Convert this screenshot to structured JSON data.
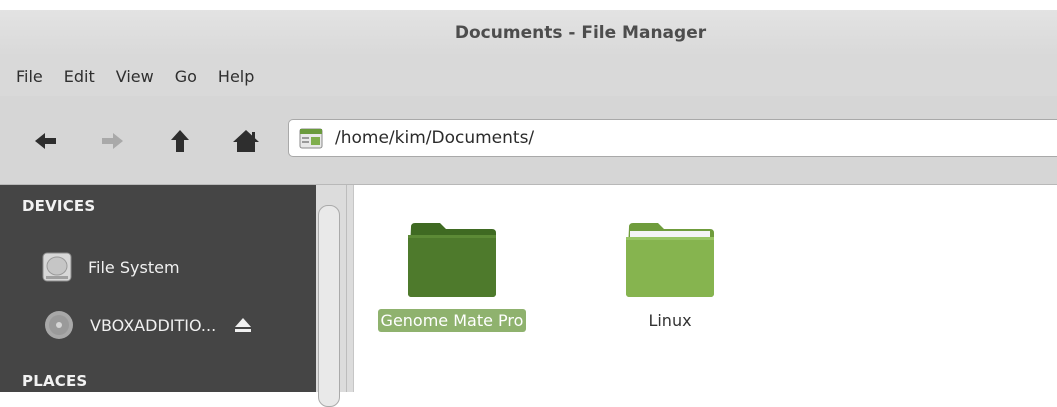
{
  "window": {
    "title": "Documents - File Manager"
  },
  "menu": [
    "File",
    "Edit",
    "View",
    "Go",
    "Help"
  ],
  "toolbar": {
    "back": "back-arrow-icon",
    "forward": "forward-arrow-icon",
    "up": "up-arrow-icon",
    "home": "home-icon"
  },
  "location": {
    "path": "/home/kim/Documents/"
  },
  "sidebar": {
    "devices_heading": "DEVICES",
    "devices": [
      {
        "label": "File System",
        "icon": "hard-drive-icon"
      },
      {
        "label": "VBOXADDITIO...",
        "icon": "optical-disc-icon",
        "eject": "eject-icon"
      }
    ],
    "places_heading": "PLACES"
  },
  "files": [
    {
      "name": "Genome Mate Pro",
      "selected": true,
      "color": "#4e7a2c"
    },
    {
      "name": "Linux",
      "selected": false,
      "color": "#86b44f"
    }
  ],
  "colors": {
    "accent": "#8fb26e",
    "sidebar_bg": "#454545"
  }
}
